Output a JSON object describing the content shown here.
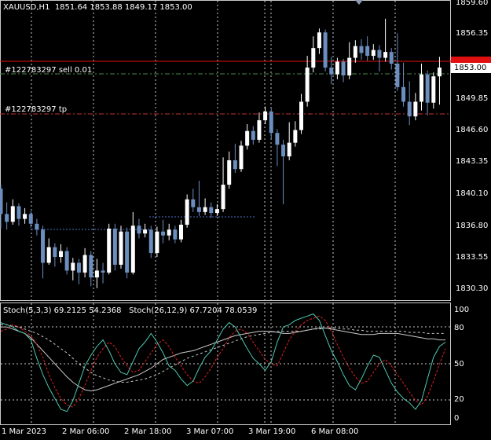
{
  "header": {
    "symbol": "XAUUSD,H1",
    "ohlc": "1851.64 1853.88 1849.17 1853.00"
  },
  "orders": {
    "sell_label": "#122783297 sell 0.01",
    "tp_label": "#122783297 tp"
  },
  "current_price": "1853.00",
  "price_axis": [
    "1859.60",
    "1856.35",
    "1853.10",
    "1849.85",
    "1846.60",
    "1843.35",
    "1840.10",
    "1836.80",
    "1833.55",
    "1830.30"
  ],
  "time_axis": [
    "1 Mar 2023",
    "2 Mar 06:00",
    "2 Mar 18:00",
    "3 Mar 07:00",
    "3 Mar 19:00",
    "6 Mar 08:00"
  ],
  "indicator": {
    "stoch1": "Stoch(5,3,3) 69.2125 54.2368",
    "stoch2": "Stoch(26,12,9) 67.7204 78.0539",
    "levels": [
      "100",
      "80",
      "50",
      "20",
      "0"
    ]
  },
  "colors": {
    "bull": "#ffffff",
    "bear": "#6c8ebf",
    "grid": "#c8c8c8",
    "sell_line": "#4a8a4a",
    "tp_line": "#c83232",
    "price_line": "#e01010",
    "stoch_main": "#4fc8b0",
    "stoch_signal": "#e02020",
    "stoch_slow": "#c8c8c8"
  }
}
